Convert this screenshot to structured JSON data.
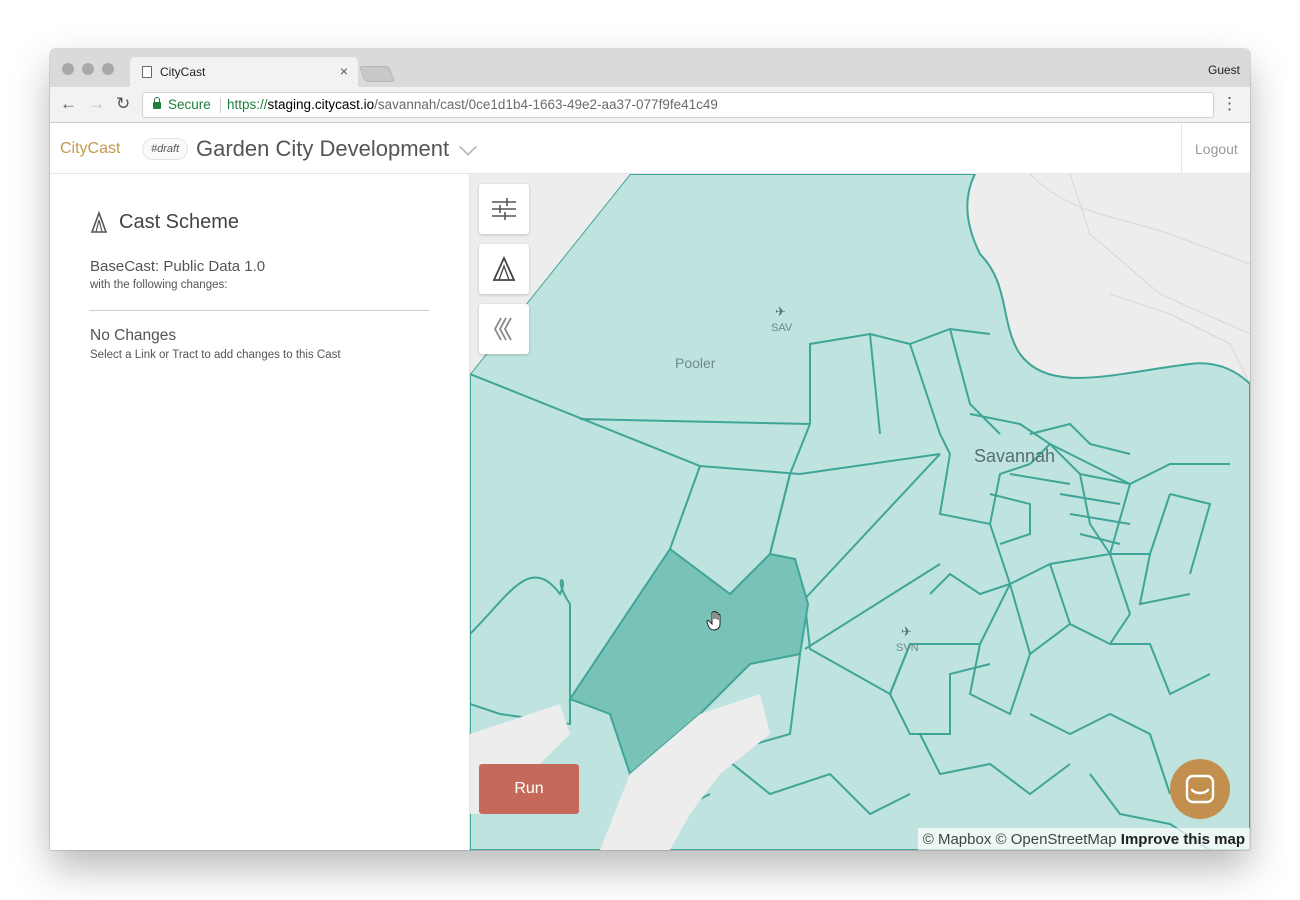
{
  "browser": {
    "tab_title": "CityCast",
    "tab_close": "×",
    "profile": "Guest",
    "secure_label": "Secure",
    "url_scheme": "https://",
    "url_host": "staging.citycast.io",
    "url_path": "/savannah/cast/0ce1d1b4-1663-49e2-aa37-077f9fe41c49",
    "back": "←",
    "forward": "→",
    "reload": "↻",
    "menu": "⋮"
  },
  "header": {
    "brand": "CityCast",
    "draft_badge": "#draft",
    "project_name": "Garden City Development",
    "logout": "Logout"
  },
  "sidebar": {
    "title": "Cast Scheme",
    "basecast": "BaseCast: Public Data 1.0",
    "basecast_sub": "with the following changes:",
    "no_changes": "No Changes",
    "no_changes_sub": "Select a Link or Tract to add changes to this Cast"
  },
  "map": {
    "controls": [
      "sliders-icon",
      "cast-scheme-icon",
      "collapse-icon"
    ],
    "run_label": "Run",
    "labels": {
      "pooler": "Pooler",
      "savannah": "Savannah",
      "sav": "SAV",
      "svn": "SVN",
      "airport": "✈"
    },
    "attribution": {
      "mapbox": "© Mapbox",
      "osm": "© OpenStreetMap",
      "improve": "Improve this map"
    }
  },
  "colors": {
    "brand": "#c39a4c",
    "run": "#c56a5a",
    "tract_fill": "#bfe3de",
    "tract_stroke": "#3fa597",
    "tract_selected": "#78c2b8",
    "chat": "#c38f4f"
  }
}
